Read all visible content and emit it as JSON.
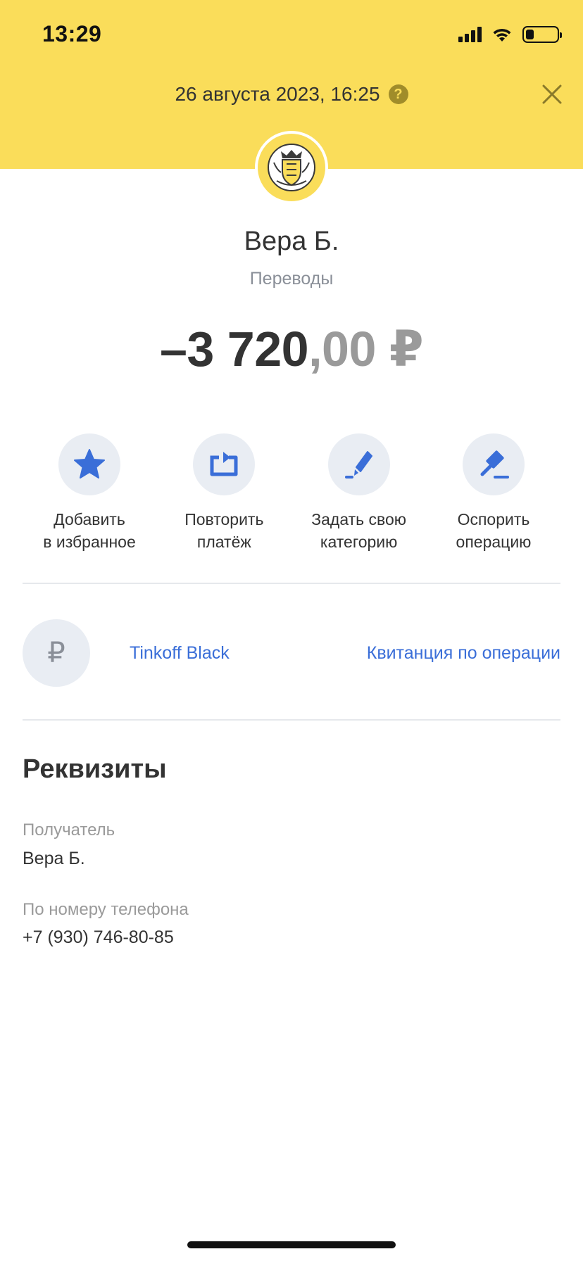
{
  "status_bar": {
    "time": "13:29",
    "battery_level": 0.25
  },
  "header": {
    "date": "26 августа 2023, 16:25",
    "help_icon": "?",
    "close_icon": "close-icon",
    "background_color": "#fadd5a"
  },
  "transaction": {
    "merchant": "Вера Б.",
    "category": "Переводы",
    "amount_integer": "–3 720",
    "amount_decimal": ",00 ₽"
  },
  "actions": [
    {
      "label": "Добавить\nв избранное",
      "icon": "star-icon"
    },
    {
      "label": "Повторить\nплатёж",
      "icon": "repeat-icon"
    },
    {
      "label": "Задать свою\nкатегорию",
      "icon": "brush-icon"
    },
    {
      "label": "Оспорить\nоперацию",
      "icon": "gavel-icon"
    }
  ],
  "card": {
    "symbol": "₽",
    "name": "Tinkoff Black",
    "receipt_link": "Квитанция по операции"
  },
  "details": {
    "title": "Реквизиты",
    "recipient_label": "Получатель",
    "recipient_value": "Вера Б.",
    "phone_label": "По номеру телефона",
    "phone_value": "+7 (930) 746-80-85"
  },
  "colors": {
    "accent": "#3a6ed8",
    "icon_bg": "#e9edf3"
  }
}
